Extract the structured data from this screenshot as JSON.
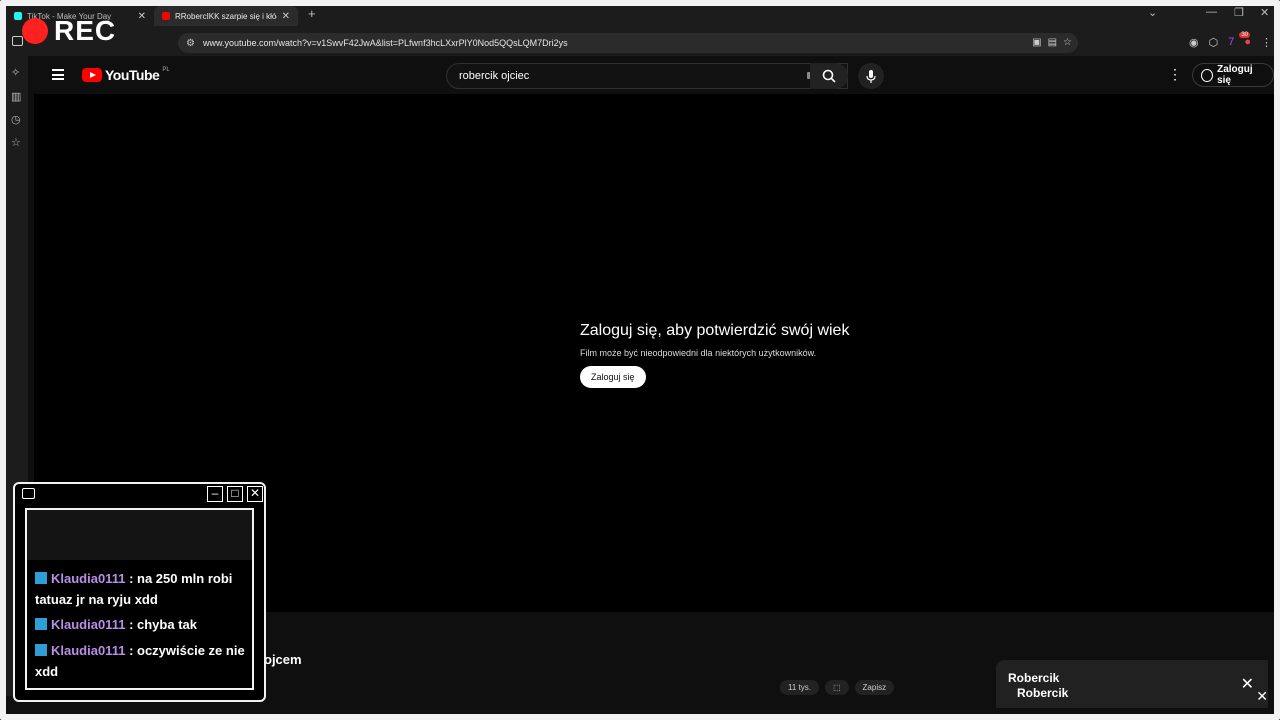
{
  "browser": {
    "tabs": [
      {
        "title": "TikTok - Make Your Day",
        "active": false,
        "favicon_color": "#25f4ee"
      },
      {
        "title": "RRobercIKK szarpie się i kłóci się",
        "active": true,
        "favicon_color": "#ff0000"
      }
    ],
    "new_tab": "+",
    "url": "www.youtube.com/watch?v=v1SwvF42JwA&list=PLfwnf3hcLXxrPlY0Nod5QQsLQM7Dri2ys",
    "ext_badge": "30"
  },
  "overlay": {
    "rec_label": "REC",
    "rec_color": "#ff2020"
  },
  "youtube": {
    "logo_text": "YouTube",
    "country_code": "PL",
    "search_query": "robercik  ojciec",
    "signin_label": "Zaloguj się"
  },
  "player": {
    "age_title": "Zaloguj się, aby potwierdzić swój wiek",
    "age_subtitle": "Film może być nieodpowiedni dla niektórych użytkowników.",
    "age_button": "Zaloguj się"
  },
  "video": {
    "title_fragment": "ojcem"
  },
  "actions": [
    "11 tys.",
    "Zapisz"
  ],
  "notification": {
    "line1": "Robercik",
    "line2": "Robercik"
  },
  "chat": {
    "messages": [
      {
        "user": "Klaudia0111",
        "text": " : na 250 mln robi tatuaz jr na ryju xdd"
      },
      {
        "user": "Klaudia0111",
        "text": " : chyba tak"
      },
      {
        "user": "Klaudia0111",
        "text": " : oczywiście ze nie xdd"
      }
    ]
  }
}
